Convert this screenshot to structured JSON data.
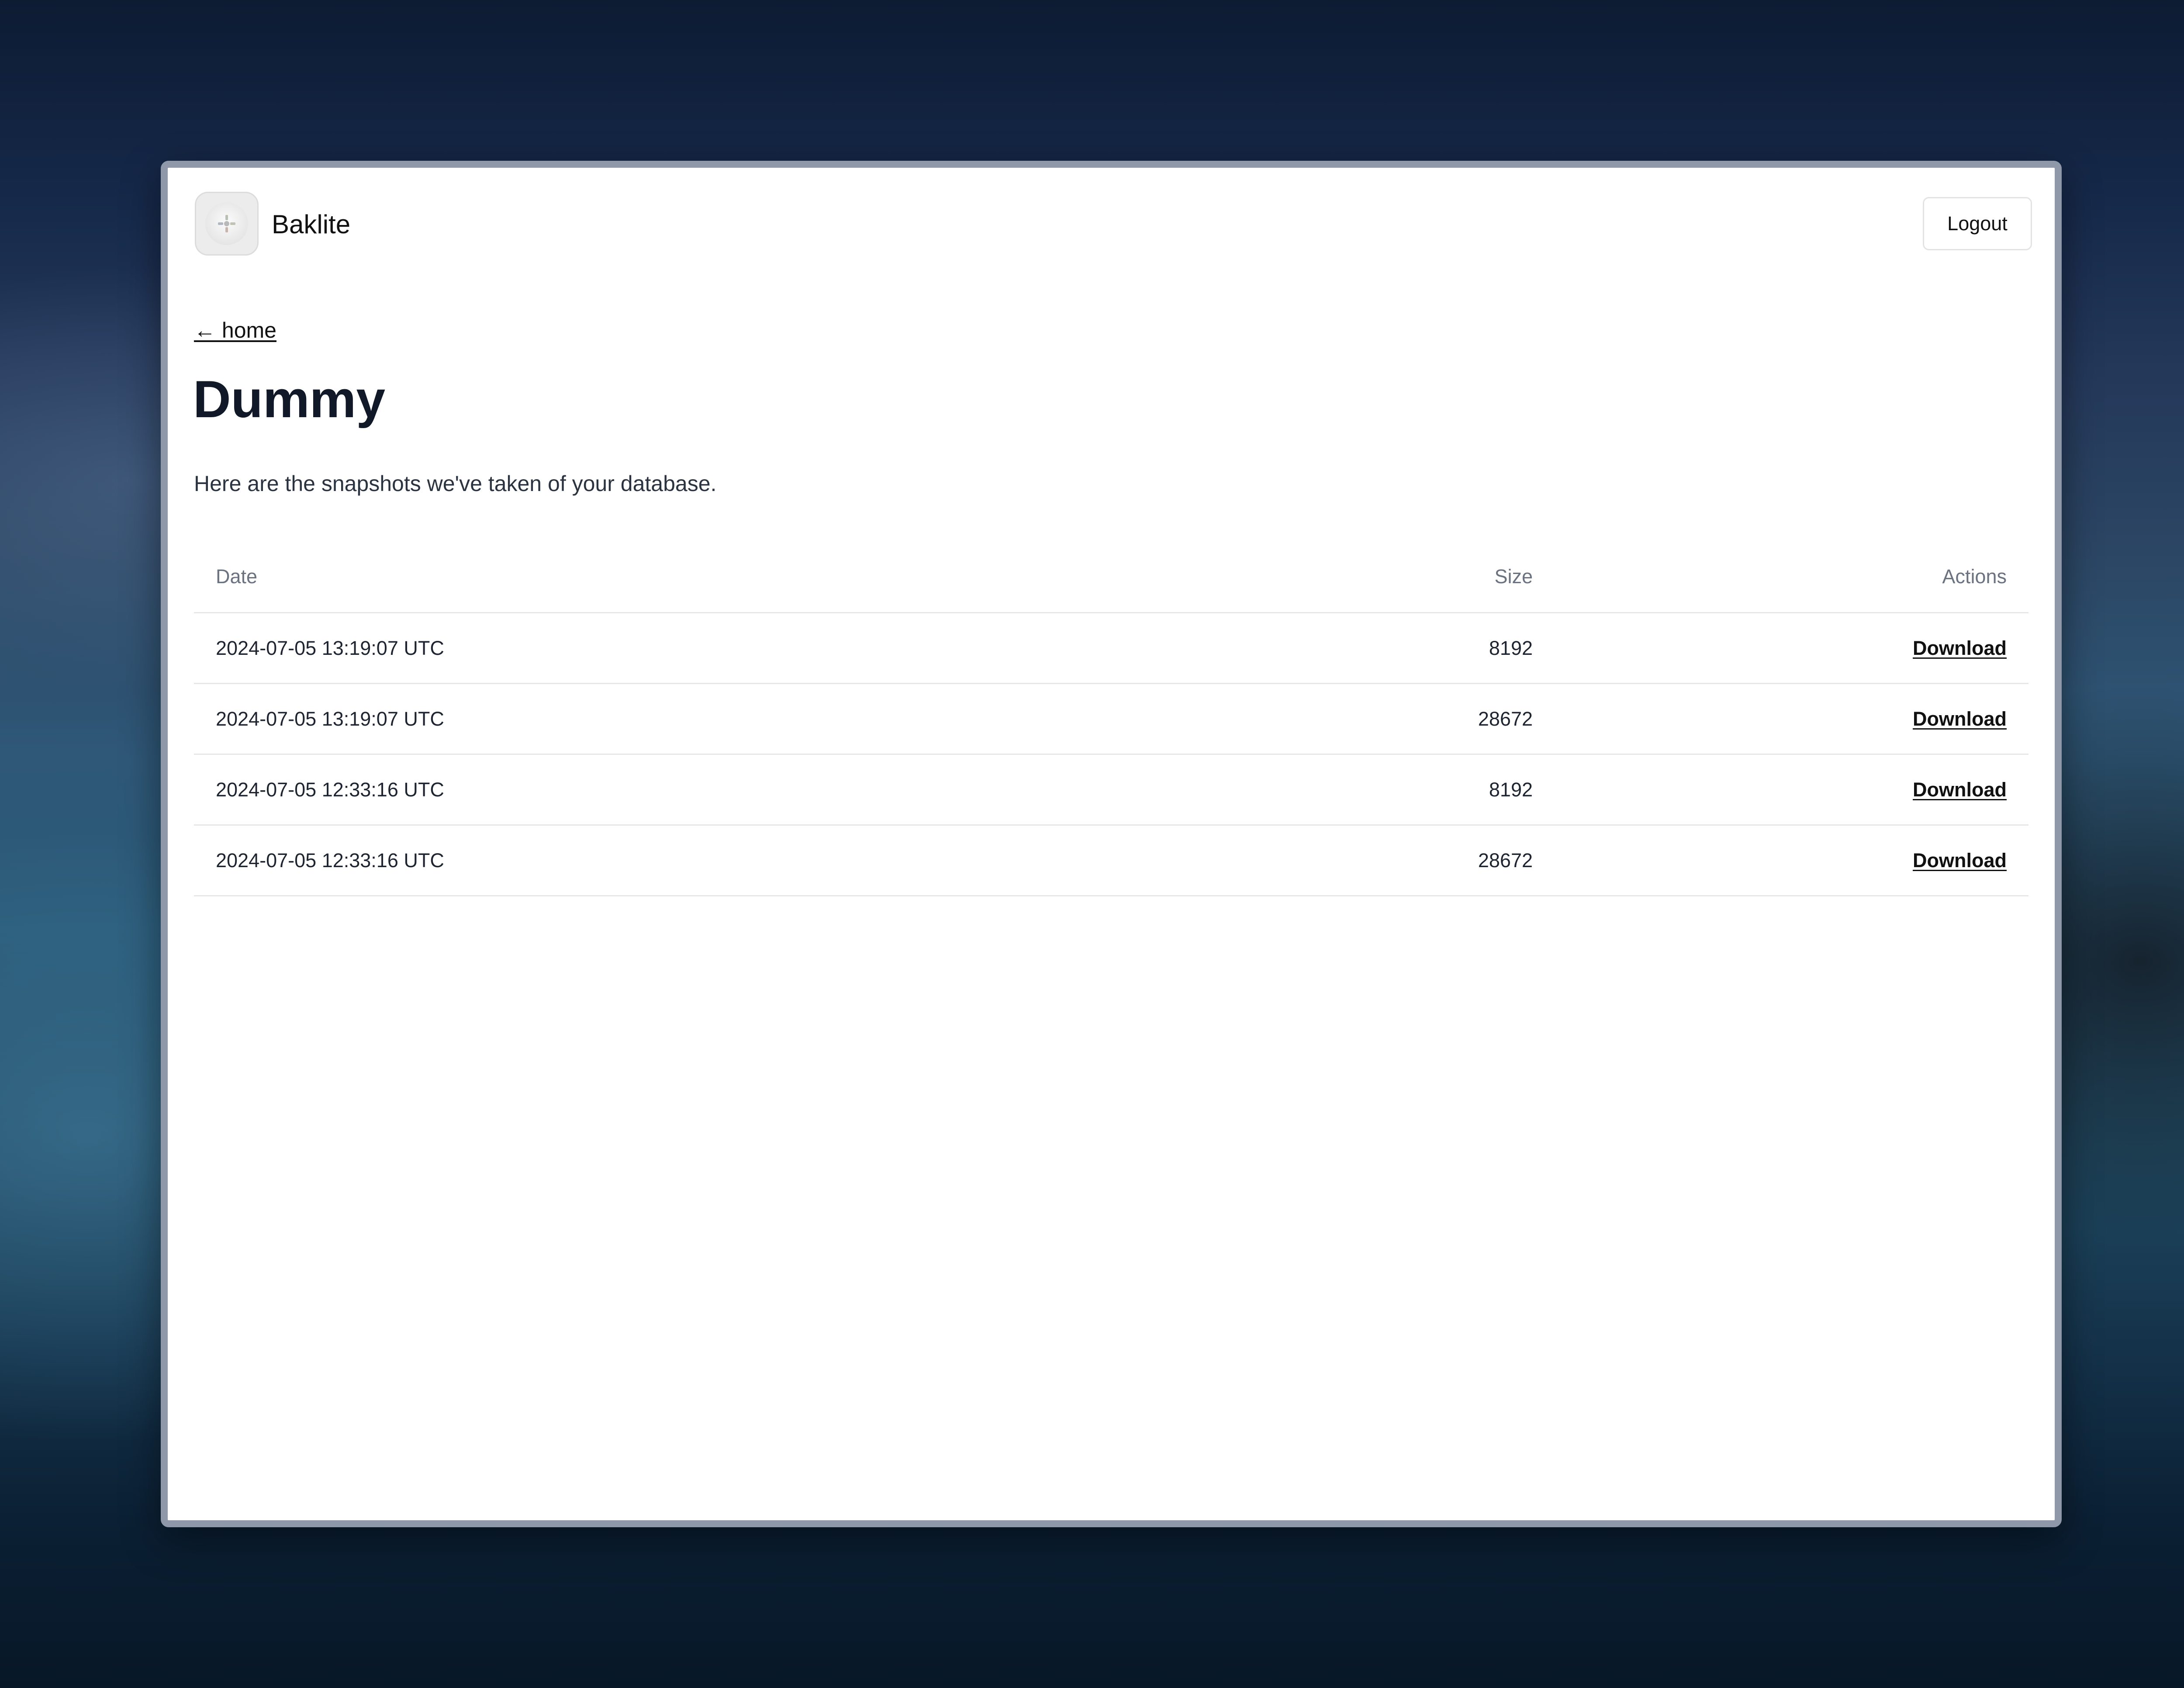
{
  "app": {
    "name": "Baklite",
    "logout_label": "Logout"
  },
  "nav": {
    "back_label": "← home"
  },
  "page": {
    "title": "Dummy",
    "description": "Here are the snapshots we've taken of your database."
  },
  "table": {
    "headers": {
      "date": "Date",
      "size": "Size",
      "actions": "Actions"
    },
    "rows": [
      {
        "date": "2024-07-05 13:19:07 UTC",
        "size": "8192",
        "action": "Download"
      },
      {
        "date": "2024-07-05 13:19:07 UTC",
        "size": "28672",
        "action": "Download"
      },
      {
        "date": "2024-07-05 12:33:16 UTC",
        "size": "8192",
        "action": "Download"
      },
      {
        "date": "2024-07-05 12:33:16 UTC",
        "size": "28672",
        "action": "Download"
      }
    ]
  },
  "icons": {
    "logo": "app-logo-icon",
    "back": "arrow-left-icon"
  },
  "colors": {
    "title": "#111827",
    "text": "#111111",
    "muted": "#6b7280",
    "border": "#e5e7eb"
  }
}
